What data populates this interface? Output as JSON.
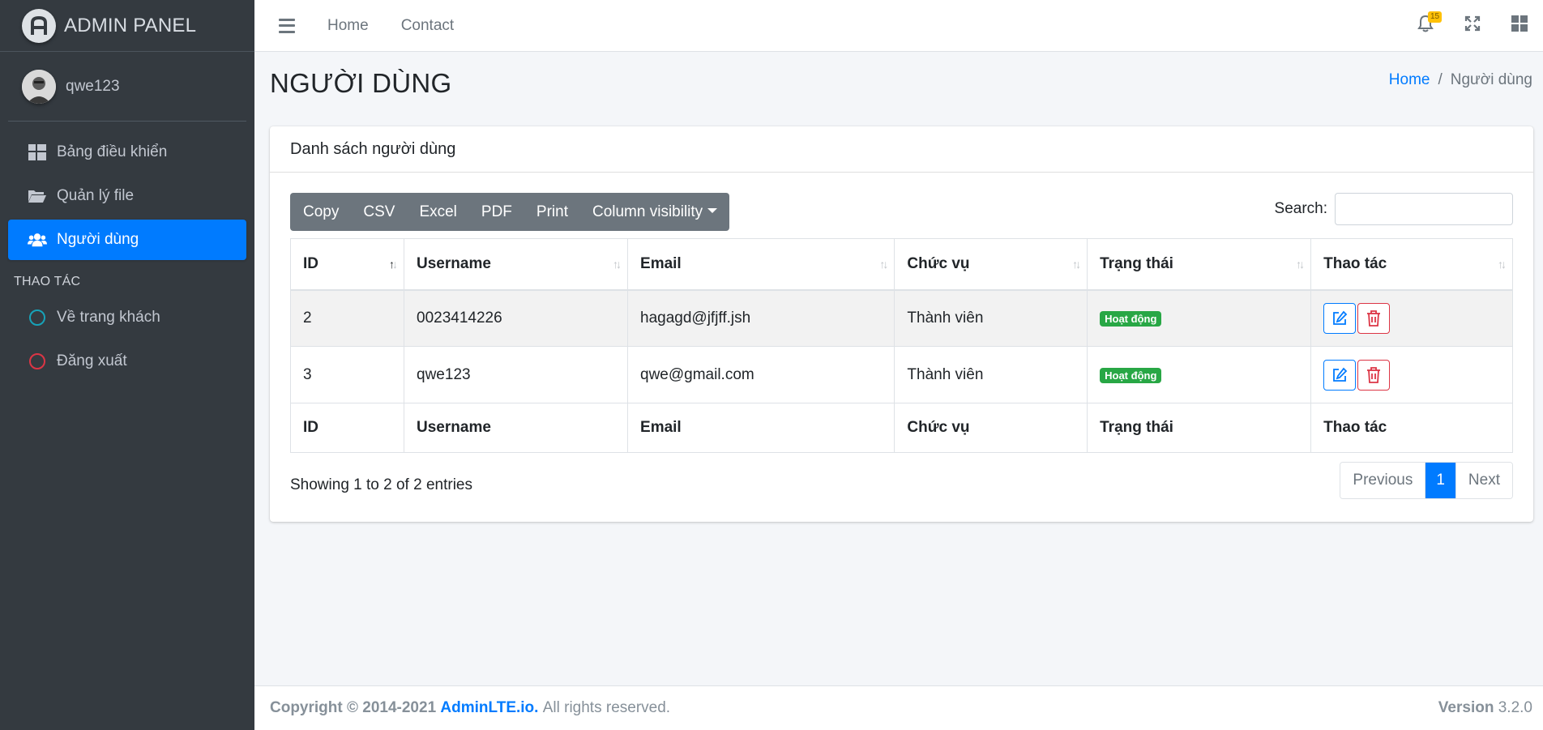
{
  "brand": {
    "name": "ADMIN PANEL"
  },
  "user": {
    "name": "qwe123"
  },
  "sidebar": {
    "items": [
      {
        "label": "Bảng điều khiển"
      },
      {
        "label": "Quản lý file"
      },
      {
        "label": "Người dùng"
      }
    ],
    "section_header": "THAO TÁC",
    "actions": [
      {
        "label": "Về trang khách"
      },
      {
        "label": "Đăng xuất"
      }
    ]
  },
  "topbar": {
    "links": [
      "Home",
      "Contact"
    ],
    "notification_count": "15"
  },
  "page": {
    "title": "NGƯỜI DÙNG",
    "breadcrumb": {
      "home": "Home",
      "separator": "/",
      "current": "Người dùng"
    }
  },
  "card": {
    "title": "Danh sách người dùng"
  },
  "toolbar": {
    "buttons": [
      "Copy",
      "CSV",
      "Excel",
      "PDF",
      "Print",
      "Column visibility"
    ]
  },
  "search": {
    "label": "Search:",
    "value": ""
  },
  "table": {
    "columns": [
      "ID",
      "Username",
      "Email",
      "Chức vụ",
      "Trạng thái",
      "Thao tác"
    ],
    "rows": [
      {
        "id": "2",
        "username": "0023414226",
        "email": "hagagd@jfjff.jsh",
        "role": "Thành viên",
        "status": "Hoạt động"
      },
      {
        "id": "3",
        "username": "qwe123",
        "email": "qwe@gmail.com",
        "role": "Thành viên",
        "status": "Hoạt động"
      }
    ]
  },
  "pagination": {
    "info": "Showing 1 to 2 of 2 entries",
    "previous": "Previous",
    "current": "1",
    "next": "Next"
  },
  "footer": {
    "copyright": "Copyright © 2014-2021",
    "link": "AdminLTE.io.",
    "rights": "All rights reserved.",
    "version_label": "Version",
    "version": "3.2.0"
  },
  "colors": {
    "sidebar_bg": "#343a40",
    "accent": "#007bff",
    "success": "#28a745",
    "danger": "#dc3545",
    "warning": "#ffc107"
  },
  "icons": {
    "dashboard": "dashboard-icon",
    "files": "folder-icon",
    "users": "users-icon",
    "guest": "circle-outline-icon",
    "logout": "circle-outline-icon",
    "notifications": "bell-icon",
    "fullscreen": "expand-icon",
    "control_sidebar": "grid-icon"
  }
}
